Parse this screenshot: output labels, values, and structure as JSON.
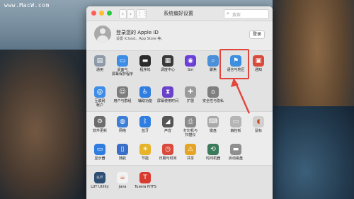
{
  "watermark": "www.MacW.com",
  "window": {
    "title": "系统偏好设置",
    "search_placeholder": "搜索",
    "traffic_lights": {
      "close": "#fd5f57",
      "minimize": "#febc2e",
      "zoom": "#28c840"
    },
    "nav": {
      "back": "‹",
      "forward": "›",
      "grid": "⋮⋮"
    }
  },
  "apple_id": {
    "title": "登录您的 Apple ID",
    "subtitle": "设置 iCloud、App Store 等。",
    "login_button": "登录"
  },
  "row1": [
    {
      "label": "通用",
      "icon": "general-icon",
      "color": "#8e9aa8",
      "glyph": "▤"
    },
    {
      "label": "桌面与\n屏幕保护程序",
      "icon": "desktop-screensaver-icon",
      "color": "#3d8de6",
      "glyph": "▭"
    },
    {
      "label": "程序坞",
      "icon": "dock-icon",
      "color": "#2b2b2b",
      "glyph": "▬"
    },
    {
      "label": "调度中心",
      "icon": "mission-control-icon",
      "color": "#3a3a3a",
      "glyph": "▦"
    },
    {
      "label": "Siri",
      "icon": "siri-icon",
      "color": "#6a3fd6",
      "glyph": "◉"
    },
    {
      "label": "聚焦",
      "icon": "spotlight-icon",
      "color": "#4a8fd8",
      "glyph": "⌕"
    },
    {
      "label": "语言与地区",
      "icon": "language-region-icon",
      "color": "#3c8fe0",
      "glyph": "⚑"
    },
    {
      "label": "通知",
      "icon": "notifications-icon",
      "color": "#d84a3b",
      "glyph": "▣"
    }
  ],
  "row2": [
    {
      "label": "互联网\n帐户",
      "icon": "internet-accounts-icon",
      "color": "#3d8de6",
      "glyph": "@"
    },
    {
      "label": "用户与群组",
      "icon": "users-groups-icon",
      "color": "#7c7c7c",
      "glyph": "☺"
    },
    {
      "label": "辅助功能",
      "icon": "accessibility-icon",
      "color": "#2f7de0",
      "glyph": "♿"
    },
    {
      "label": "屏幕使用时间",
      "icon": "screen-time-icon",
      "color": "#6a42c9",
      "glyph": "⧗"
    },
    {
      "label": "扩展",
      "icon": "extensions-icon",
      "color": "#9a9a9a",
      "glyph": "✚"
    },
    {
      "label": "安全性与隐私",
      "icon": "security-privacy-icon",
      "color": "#7f7f7f",
      "glyph": "⌂"
    }
  ],
  "row3": [
    {
      "label": "软件更新",
      "icon": "software-update-icon",
      "color": "#6d6d6d",
      "glyph": "⚙"
    },
    {
      "label": "网络",
      "icon": "network-icon",
      "color": "#3d7fd6",
      "glyph": "◍"
    },
    {
      "label": "蓝牙",
      "icon": "bluetooth-icon",
      "color": "#2f7de0",
      "glyph": "ᛒ"
    },
    {
      "label": "声音",
      "icon": "sound-icon",
      "color": "#555555",
      "glyph": "◢"
    },
    {
      "label": "打印机与\n扫描仪",
      "icon": "printers-scanners-icon",
      "color": "#8a8a8a",
      "glyph": "⎙"
    },
    {
      "label": "键盘",
      "icon": "keyboard-icon",
      "color": "#a9a9a9",
      "glyph": "⌨"
    },
    {
      "label": "触控板",
      "icon": "trackpad-icon",
      "color": "#b5b5b5",
      "glyph": "▭"
    },
    {
      "label": "鼠标",
      "icon": "mouse-icon",
      "color": "#d0d0d0",
      "glyph": "◖"
    }
  ],
  "row4": [
    {
      "label": "显示器",
      "icon": "displays-icon",
      "color": "#2f7de0",
      "glyph": "▭"
    },
    {
      "label": "随航",
      "icon": "sidecar-icon",
      "color": "#3b6fc7",
      "glyph": "▯"
    },
    {
      "label": "节能",
      "icon": "energy-saver-icon",
      "color": "#e6b329",
      "glyph": "☀"
    },
    {
      "label": "日期与时间",
      "icon": "date-time-icon",
      "color": "#d84a3b",
      "glyph": "◷"
    },
    {
      "label": "共享",
      "icon": "sharing-icon",
      "color": "#e5a423",
      "glyph": "⚠"
    },
    {
      "label": "时间机器",
      "icon": "time-machine-icon",
      "color": "#3c7a5c",
      "glyph": "⟲"
    },
    {
      "label": "启动磁盘",
      "icon": "startup-disk-icon",
      "color": "#8f8f8f",
      "glyph": "▬"
    }
  ],
  "row5": [
    {
      "label": "LUT Utility",
      "icon": "lut-utility-icon",
      "color": "#2d4f73",
      "glyph": "LUT"
    },
    {
      "label": "Java",
      "icon": "java-icon",
      "color": "#f2f2f2",
      "glyph": "☕"
    },
    {
      "label": "Tuxera NTFS",
      "icon": "tuxera-ntfs-icon",
      "color": "#d83b2f",
      "glyph": "T"
    }
  ]
}
